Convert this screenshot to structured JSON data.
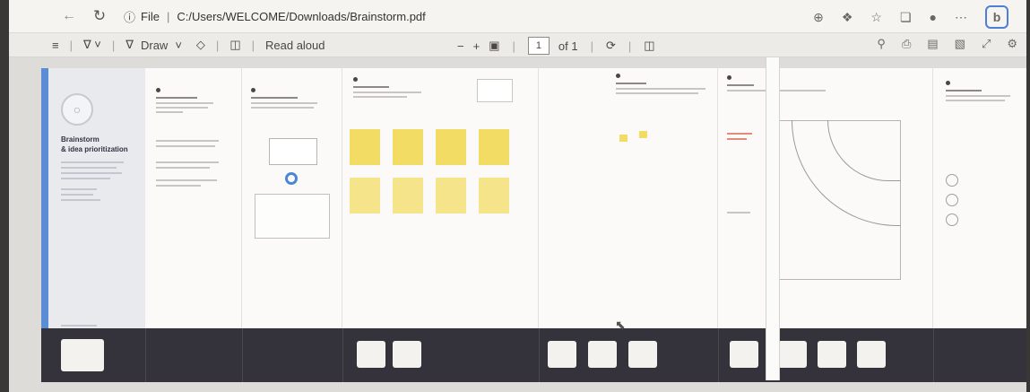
{
  "browser": {
    "back_icon": "arrow-left-icon",
    "refresh_icon": "refresh-icon",
    "info_icon": "info-icon",
    "file_label": "File",
    "path": "C:/Users/WELCOME/Downloads/Brainstorm.pdf",
    "right_icons": [
      "zoom-icon",
      "read-mode-icon",
      "favorites-icon",
      "collections-icon",
      "profile-icon",
      "more-icon"
    ],
    "bing_label": "b"
  },
  "pdf_toolbar": {
    "draw_label": "Draw",
    "read_aloud_label": "Read aloud",
    "zoom_out": "−",
    "zoom_in": "+",
    "page_current": "1",
    "page_total": "of 1"
  },
  "board": {
    "hero_title_line1": "Brainstorm",
    "hero_title_line2": "& idea prioritization"
  },
  "colors": {
    "accent_blue": "#5b8dd6",
    "sticky_yellow": "#f3dc64",
    "footer": "#34323a",
    "bing_blue": "#3a67c2"
  }
}
